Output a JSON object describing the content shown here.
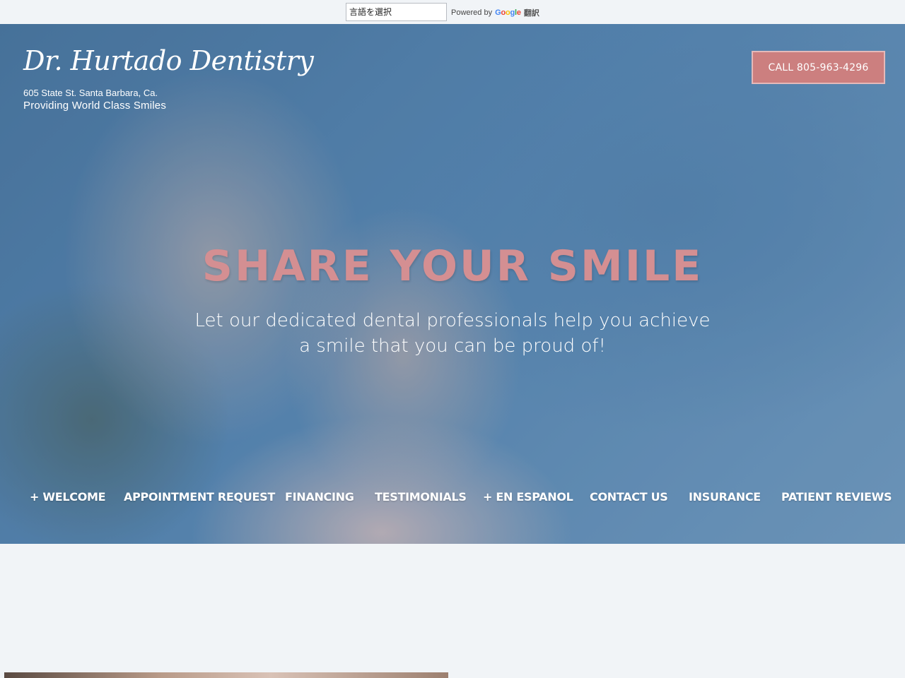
{
  "translate": {
    "select_label": "言語を選択",
    "powered_by": "Powered by",
    "google_letters": [
      "G",
      "o",
      "o",
      "g",
      "l",
      "e"
    ],
    "translate_word": "翻訳"
  },
  "header": {
    "brand_name": "Dr. Hurtado Dentistry",
    "address": "605 State St. Santa Barbara, Ca.",
    "tagline": "Providing World Class Smiles",
    "call_button": "CALL 805-963-4296"
  },
  "hero": {
    "headline": "SHARE YOUR SMILE",
    "subhead": "Let our dedicated dental professionals help you achieve a smile that you can be proud of!"
  },
  "nav": {
    "items": [
      {
        "label": "+ WELCOME"
      },
      {
        "label": "APPOINTMENT REQUEST"
      },
      {
        "label": "FINANCING"
      },
      {
        "label": "TESTIMONIALS"
      },
      {
        "label": "+ EN ESPANOL"
      },
      {
        "label": "CONTACT US"
      },
      {
        "label": "INSURANCE"
      },
      {
        "label": "PATIENT REVIEWS"
      }
    ]
  },
  "colors": {
    "accent_pink": "#cc7f7f",
    "headline_pink": "#d48f92",
    "page_bg": "#f1f4f7"
  }
}
